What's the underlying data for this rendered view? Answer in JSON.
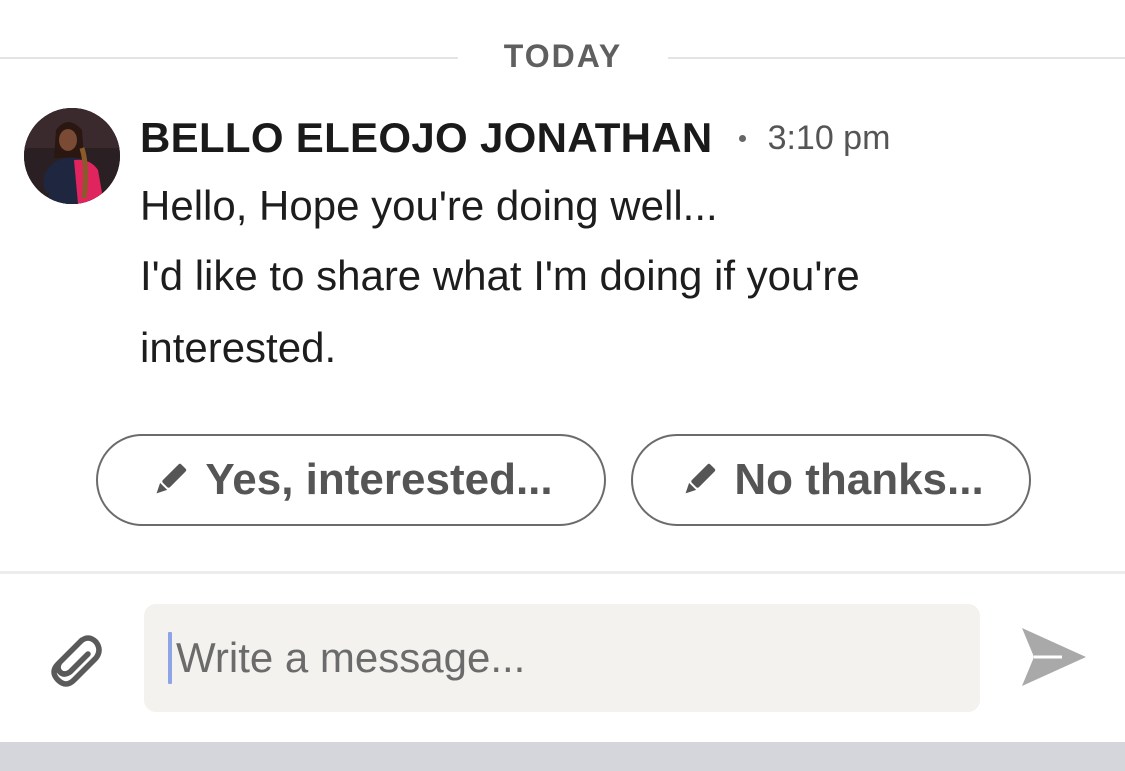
{
  "day_divider": {
    "label": "TODAY"
  },
  "message": {
    "sender_name": "BELLO ELEOJO JONATHAN",
    "time": "3:10 pm",
    "lines": [
      "Hello, Hope you're doing well...",
      "I'd like to share what I'm doing if you're",
      "interested."
    ],
    "avatar_icon": "profile-photo"
  },
  "quick_replies": [
    {
      "label": "Yes, interested...",
      "icon": "pencil-icon"
    },
    {
      "label": "No thanks...",
      "icon": "pencil-icon"
    }
  ],
  "composer": {
    "placeholder": "Write a message...",
    "attach_icon": "paperclip-icon",
    "send_icon": "send-icon"
  },
  "colors": {
    "chip_border": "#6b6b6b",
    "input_bg": "#f3f2ef",
    "caret": "#8ea4e6",
    "send_icon": "#a9a9a9",
    "bottom_bar": "#d4d6dc"
  }
}
